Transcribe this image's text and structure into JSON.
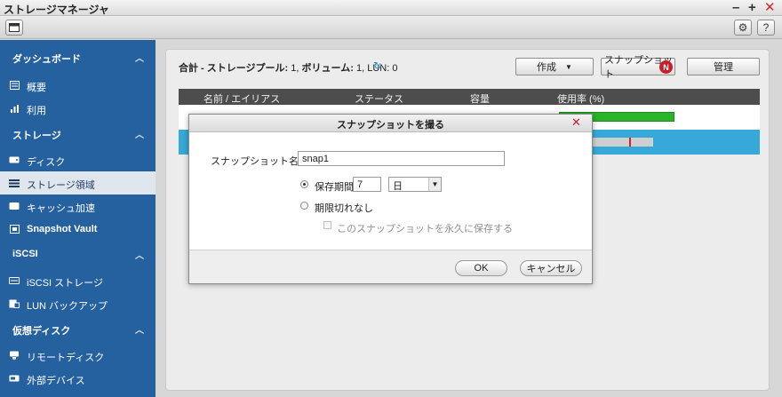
{
  "window": {
    "title": "ストレージマネージャ"
  },
  "sidebar": {
    "sections": [
      {
        "label": "ダッシュボード",
        "items": [
          "概要",
          "利用"
        ]
      },
      {
        "label": "ストレージ",
        "items": [
          "ディスク",
          "ストレージ領域",
          "キャッシュ加速",
          "Snapshot Vault"
        ]
      },
      {
        "label": "iSCSI",
        "items": [
          "iSCSI ストレージ",
          "LUN バックアップ"
        ]
      },
      {
        "label": "仮想ディスク",
        "items": [
          "リモートディスク",
          "外部デバイス"
        ]
      }
    ],
    "active_item": "ストレージ領域"
  },
  "main": {
    "summary_prefix": "合計 - ",
    "summary_pool_label": "ストレージプール:",
    "summary_pool_count": "1,",
    "summary_volume_label": "ボリューム:",
    "summary_volume_count": "1,",
    "summary_lun_label": "LUN:",
    "summary_lun_count": "0",
    "create_button": "作成",
    "snapshot_button": "スナップショット",
    "snapshot_badge": "N",
    "manage_button": "管理",
    "columns": [
      "名前 / エイリアス",
      "ステータス",
      "容量",
      "使用率 (%)"
    ]
  },
  "dialog": {
    "title": "スナップショットを撮る",
    "name_label": "スナップショット名:",
    "name_value": "snap1",
    "retention_label": "保存期間",
    "retention_value": "7",
    "retention_unit": "日",
    "no_expiry_label": "期限切れなし",
    "keep_forever_label": "このスナップショットを永久に保存する",
    "ok_button": "OK",
    "cancel_button": "キャンセル"
  },
  "colors": {
    "sidebar": "#25609f",
    "accent": "#37a9d8",
    "usage_bar": "#2bb32b",
    "badge": "#c8202a"
  }
}
